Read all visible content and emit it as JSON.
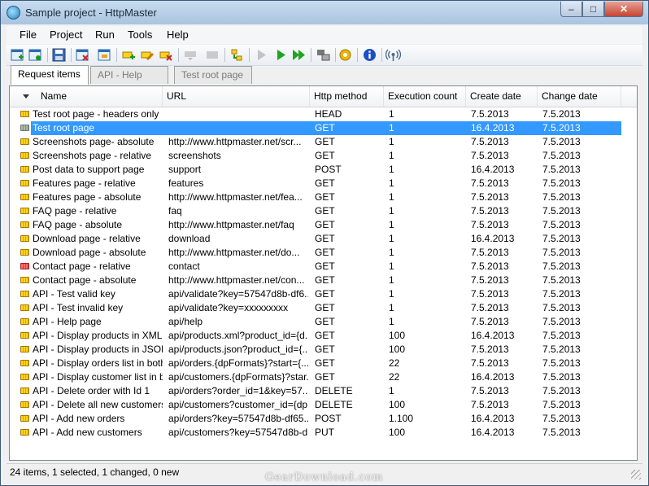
{
  "window": {
    "title": "Sample project - HttpMaster"
  },
  "menu": [
    "File",
    "Project",
    "Run",
    "Tools",
    "Help"
  ],
  "toolbar_icons": [
    "new-request-icon",
    "new-request-copy-icon",
    "save-icon",
    "delete-project-icon",
    "properties-icon",
    "add-item-icon",
    "edit-item-icon",
    "delete-item-icon",
    "move-down-icon",
    "move-icon",
    "import-icon",
    "run-step-icon",
    "run-icon",
    "run-all-icon",
    "response-icon",
    "settings-icon",
    "info-icon",
    "broadcast-icon"
  ],
  "tabs": [
    "Request items",
    "API - Help page",
    "Test root page"
  ],
  "columns": [
    "Name",
    "URL",
    "Http method",
    "Execution count",
    "Create date",
    "Change date"
  ],
  "rows": [
    {
      "name": "Test root page - headers only",
      "url": "",
      "method": "HEAD",
      "count": "1",
      "create": "7.5.2013",
      "change": "7.5.2013",
      "icon": "yellow"
    },
    {
      "name": "Test root page",
      "url": "",
      "method": "GET",
      "count": "1",
      "create": "16.4.2013",
      "change": "7.5.2013",
      "icon": "grey"
    },
    {
      "name": "Screenshots page- absolute",
      "url": "http://www.httpmaster.net/scr...",
      "method": "GET",
      "count": "1",
      "create": "7.5.2013",
      "change": "7.5.2013",
      "icon": "yellow"
    },
    {
      "name": "Screenshots page - relative",
      "url": "screenshots",
      "method": "GET",
      "count": "1",
      "create": "7.5.2013",
      "change": "7.5.2013",
      "icon": "yellow"
    },
    {
      "name": "Post data to support page",
      "url": "support",
      "method": "POST",
      "count": "1",
      "create": "16.4.2013",
      "change": "7.5.2013",
      "icon": "yellow"
    },
    {
      "name": "Features page - relative",
      "url": "features",
      "method": "GET",
      "count": "1",
      "create": "7.5.2013",
      "change": "7.5.2013",
      "icon": "yellow"
    },
    {
      "name": "Features page - absolute",
      "url": "http://www.httpmaster.net/fea...",
      "method": "GET",
      "count": "1",
      "create": "7.5.2013",
      "change": "7.5.2013",
      "icon": "yellow"
    },
    {
      "name": "FAQ page - relative",
      "url": "faq",
      "method": "GET",
      "count": "1",
      "create": "7.5.2013",
      "change": "7.5.2013",
      "icon": "yellow"
    },
    {
      "name": "FAQ page - absolute",
      "url": "http://www.httpmaster.net/faq",
      "method": "GET",
      "count": "1",
      "create": "7.5.2013",
      "change": "7.5.2013",
      "icon": "yellow"
    },
    {
      "name": "Download page - relative",
      "url": "download",
      "method": "GET",
      "count": "1",
      "create": "16.4.2013",
      "change": "7.5.2013",
      "icon": "yellow"
    },
    {
      "name": "Download page - absolute",
      "url": "http://www.httpmaster.net/do...",
      "method": "GET",
      "count": "1",
      "create": "7.5.2013",
      "change": "7.5.2013",
      "icon": "yellow"
    },
    {
      "name": "Contact page - relative",
      "url": "contact",
      "method": "GET",
      "count": "1",
      "create": "7.5.2013",
      "change": "7.5.2013",
      "icon": "red"
    },
    {
      "name": "Contact page - absolute",
      "url": "http://www.httpmaster.net/con...",
      "method": "GET",
      "count": "1",
      "create": "7.5.2013",
      "change": "7.5.2013",
      "icon": "yellow"
    },
    {
      "name": "API - Test valid key",
      "url": "api/validate?key=57547d8b-df6...",
      "method": "GET",
      "count": "1",
      "create": "7.5.2013",
      "change": "7.5.2013",
      "icon": "yellow"
    },
    {
      "name": "API - Test invalid key",
      "url": "api/validate?key=xxxxxxxxx",
      "method": "GET",
      "count": "1",
      "create": "7.5.2013",
      "change": "7.5.2013",
      "icon": "yellow"
    },
    {
      "name": "API - Help page",
      "url": "api/help",
      "method": "GET",
      "count": "1",
      "create": "7.5.2013",
      "change": "7.5.2013",
      "icon": "yellow"
    },
    {
      "name": "API - Display products in XML",
      "url": "api/products.xml?product_id={d...",
      "method": "GET",
      "count": "100",
      "create": "16.4.2013",
      "change": "7.5.2013",
      "icon": "yellow"
    },
    {
      "name": "API - Display products in JSON",
      "url": "api/products.json?product_id={...",
      "method": "GET",
      "count": "100",
      "create": "7.5.2013",
      "change": "7.5.2013",
      "icon": "yellow"
    },
    {
      "name": "API - Display orders list in both...",
      "url": "api/orders.{dpFormats}?start={...",
      "method": "GET",
      "count": "22",
      "create": "7.5.2013",
      "change": "7.5.2013",
      "icon": "yellow"
    },
    {
      "name": "API - Display customer list in b...",
      "url": "api/customers.{dpFormats}?star...",
      "method": "GET",
      "count": "22",
      "create": "16.4.2013",
      "change": "7.5.2013",
      "icon": "yellow"
    },
    {
      "name": "API - Delete order with Id 1",
      "url": "api/orders?order_id=1&key=57...",
      "method": "DELETE",
      "count": "1",
      "create": "7.5.2013",
      "change": "7.5.2013",
      "icon": "yellow"
    },
    {
      "name": "API - Delete all new customers",
      "url": "api/customers?customer_id={dp...",
      "method": "DELETE",
      "count": "100",
      "create": "7.5.2013",
      "change": "7.5.2013",
      "icon": "yellow"
    },
    {
      "name": "API - Add new orders",
      "url": "api/orders?key=57547d8b-df65...",
      "method": "POST",
      "count": "1.100",
      "create": "16.4.2013",
      "change": "7.5.2013",
      "icon": "yellow"
    },
    {
      "name": "API - Add new customers",
      "url": "api/customers?key=57547d8b-d...",
      "method": "PUT",
      "count": "100",
      "create": "16.4.2013",
      "change": "7.5.2013",
      "icon": "yellow"
    }
  ],
  "selected_index": 1,
  "status": "24 items, 1 selected, 1 changed, 0 new",
  "watermark": "GearDownload.com"
}
